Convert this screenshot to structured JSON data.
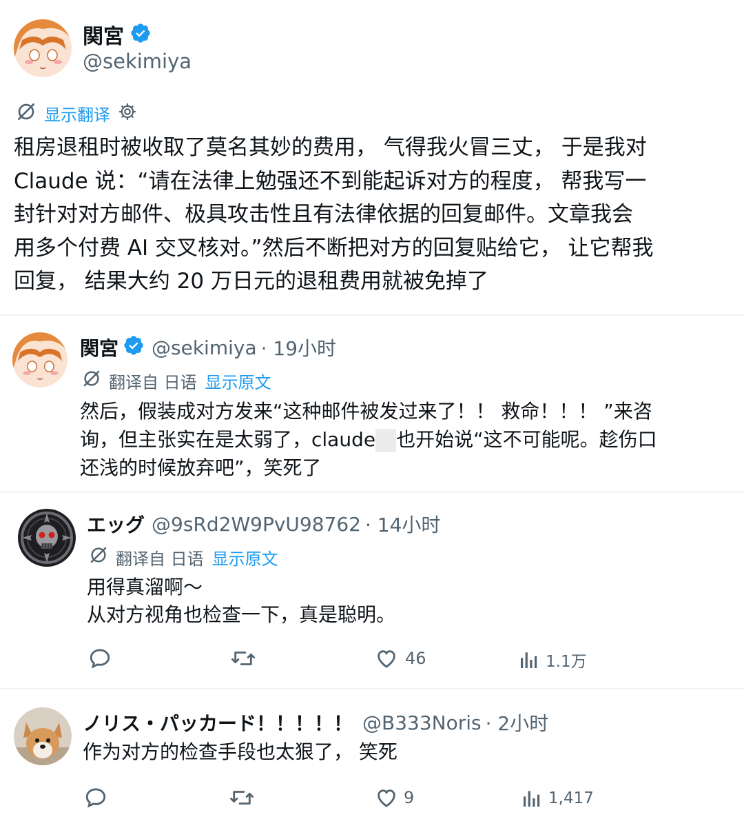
{
  "main_post": {
    "author_name": "関宮",
    "author_handle": "@sekimiya",
    "translate_label": "显示翻译",
    "text_lines": [
      "租房退租时被收取了莫名其妙的费用， 气得我火冒三丈， 于是我对",
      "Claude 说：“请在法律上勉强还不到能起诉对方的程度， 帮我写一",
      "封针对对方邮件、极具攻击性且有法律依据的回复邮件。文章我会",
      "用多个付费 AI 交叉核对。”然后不断把对方的回复贴给它， 让它帮我",
      "回复， 结果大约 20 万日元的退租费用就被免掉了"
    ]
  },
  "reply1": {
    "author_name": "関宮",
    "author_handle": "@sekimiya",
    "time": "· 19小时",
    "translated_from": "翻译自 日语",
    "show_original": "显示原文",
    "line1": "然后，假装成对方发来“这种邮件被发过来了！！ 救命！！！ ”来咨",
    "line2_a": "询，但主张实在是太弱了，claude",
    "line2_b": "也开始说“这不可能呢。趁伤口",
    "line3": "还浅的时候放弃吧”，笑死了"
  },
  "reply2": {
    "author_name": "エッグ",
    "author_handle": "@9sRd2W9PvU98762",
    "time": "· 14小时",
    "translated_from": "翻译自 日语",
    "show_original": "显示原文",
    "text_lines": [
      "用得真溜啊～",
      "从对方视角也检查一下，真是聪明。"
    ],
    "likes": "46",
    "views": "1.1万"
  },
  "reply3": {
    "author_name": "ノリス・パッカード！！！！！",
    "author_handle": "@B333Noris",
    "time": "· 2小时",
    "text_lines": [
      "作为对方的检查手段也太狠了， 笑死"
    ],
    "likes": "9",
    "views": "1,417"
  },
  "colors": {
    "accent": "#1d9bf0",
    "text": "#0f1419",
    "muted": "#536471",
    "divider": "#eff3f4"
  },
  "icons": [
    "verified-badge-icon",
    "translate-icon",
    "gear-icon",
    "reply-icon",
    "retweet-icon",
    "like-icon",
    "views-icon"
  ]
}
